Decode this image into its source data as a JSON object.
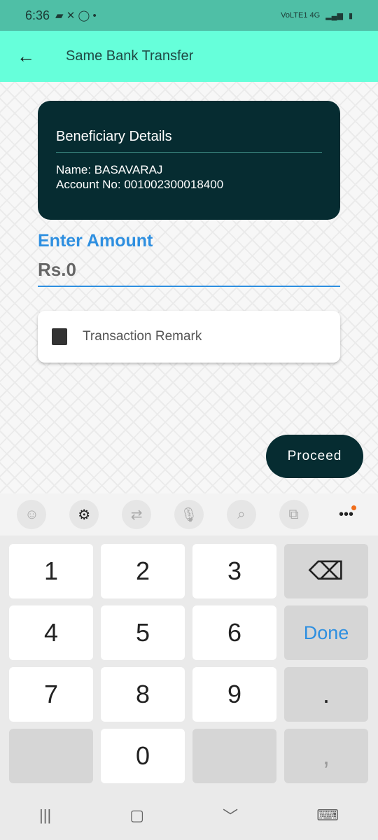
{
  "status": {
    "time": "6:36",
    "network": "VoLTE1 4G"
  },
  "appbar": {
    "title": "Same Bank Transfer"
  },
  "beneficiary": {
    "heading": "Beneficiary Details",
    "name": "Name: BASAVARAJ",
    "account": "Account No: 001002300018400"
  },
  "amount": {
    "label": "Enter Amount",
    "value": "Rs.0"
  },
  "remark": {
    "placeholder": "Transaction Remark"
  },
  "proceed_label": "Proceed",
  "keyboard": {
    "keys": [
      "1",
      "2",
      "3",
      "⌫",
      "4",
      "5",
      "6",
      "Done",
      "7",
      "8",
      "9",
      ".",
      "",
      "0",
      "",
      ","
    ]
  },
  "colors": {
    "appbar": "#66ffda",
    "card": "#062c31",
    "accent": "#2e8fe0"
  }
}
